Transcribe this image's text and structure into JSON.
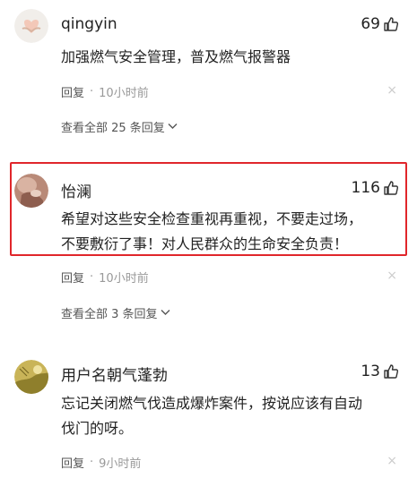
{
  "comments": [
    {
      "username": "qingyin",
      "likes": "69",
      "text": [
        "加强燃气安全管理，普及燃气报警器"
      ],
      "reply_label": "回复",
      "separator": "·",
      "time": "10小时前",
      "view_all": "查看全部 25 条回复",
      "close": "×"
    },
    {
      "username": "怡澜",
      "likes": "116",
      "text": [
        "希望对这些安全检查重视再重视，不要走过场，",
        "不要敷衍了事！对人民群众的生命安全负责！"
      ],
      "reply_label": "回复",
      "separator": "·",
      "time": "10小时前",
      "view_all": "查看全部 3 条回复",
      "close": "×"
    },
    {
      "username": "用户名朝气蓬勃",
      "likes": "13",
      "text": [
        "忘记关闭燃气伐造成爆炸案件，按说应该有自动",
        "伐门的呀。"
      ],
      "reply_label": "回复",
      "separator": "·",
      "time": "9小时前",
      "close": "×"
    }
  ],
  "colors": {
    "highlight_border": "#e0262b",
    "meta_text": "#999999",
    "text": "#222222"
  },
  "icons": {
    "like": "thumbs-up-icon",
    "chevron": "chevron-down-icon",
    "close": "close-icon"
  }
}
